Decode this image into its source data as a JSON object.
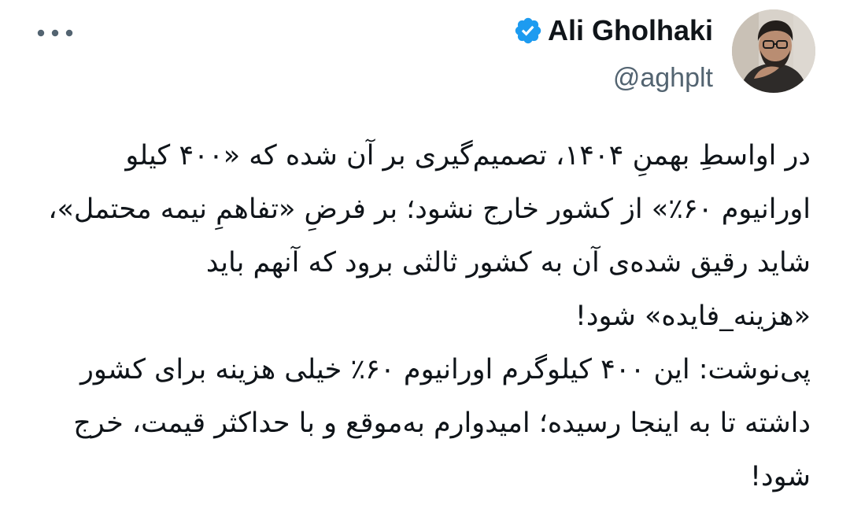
{
  "author": {
    "display_name": "Ali Gholhaki",
    "handle": "@aghplt",
    "verified": true,
    "avatar_icon": "profile-photo"
  },
  "menu": {
    "icon": "more-horizontal-icon"
  },
  "tweet": {
    "text": "در اواسطِ بهمنِ ۱۴۰۴، تصمیم‌گیری بر آن شده که «۴۰۰ کیلو اورانیوم ۶۰٪» از کشور خارج نشود؛ بر فرضِ «تفاهمِ نیمه محتمل»، شاید رقیق شده‌ی آن به کشور ثالثی برود که آنهم باید «هزینه_فایده» شود!\nپی‌نوشت: این ۴۰۰ کیلوگرم اورانیوم ۶۰٪ خیلی هزینه برای کشور داشته تا به اینجا رسیده؛ امیدوارم به‌موقع و با حداکثر قیمت، خرج شود!"
  },
  "colors": {
    "verified_badge": "#1d9bf0",
    "secondary_text": "#536471",
    "primary_text": "#0f1419"
  }
}
